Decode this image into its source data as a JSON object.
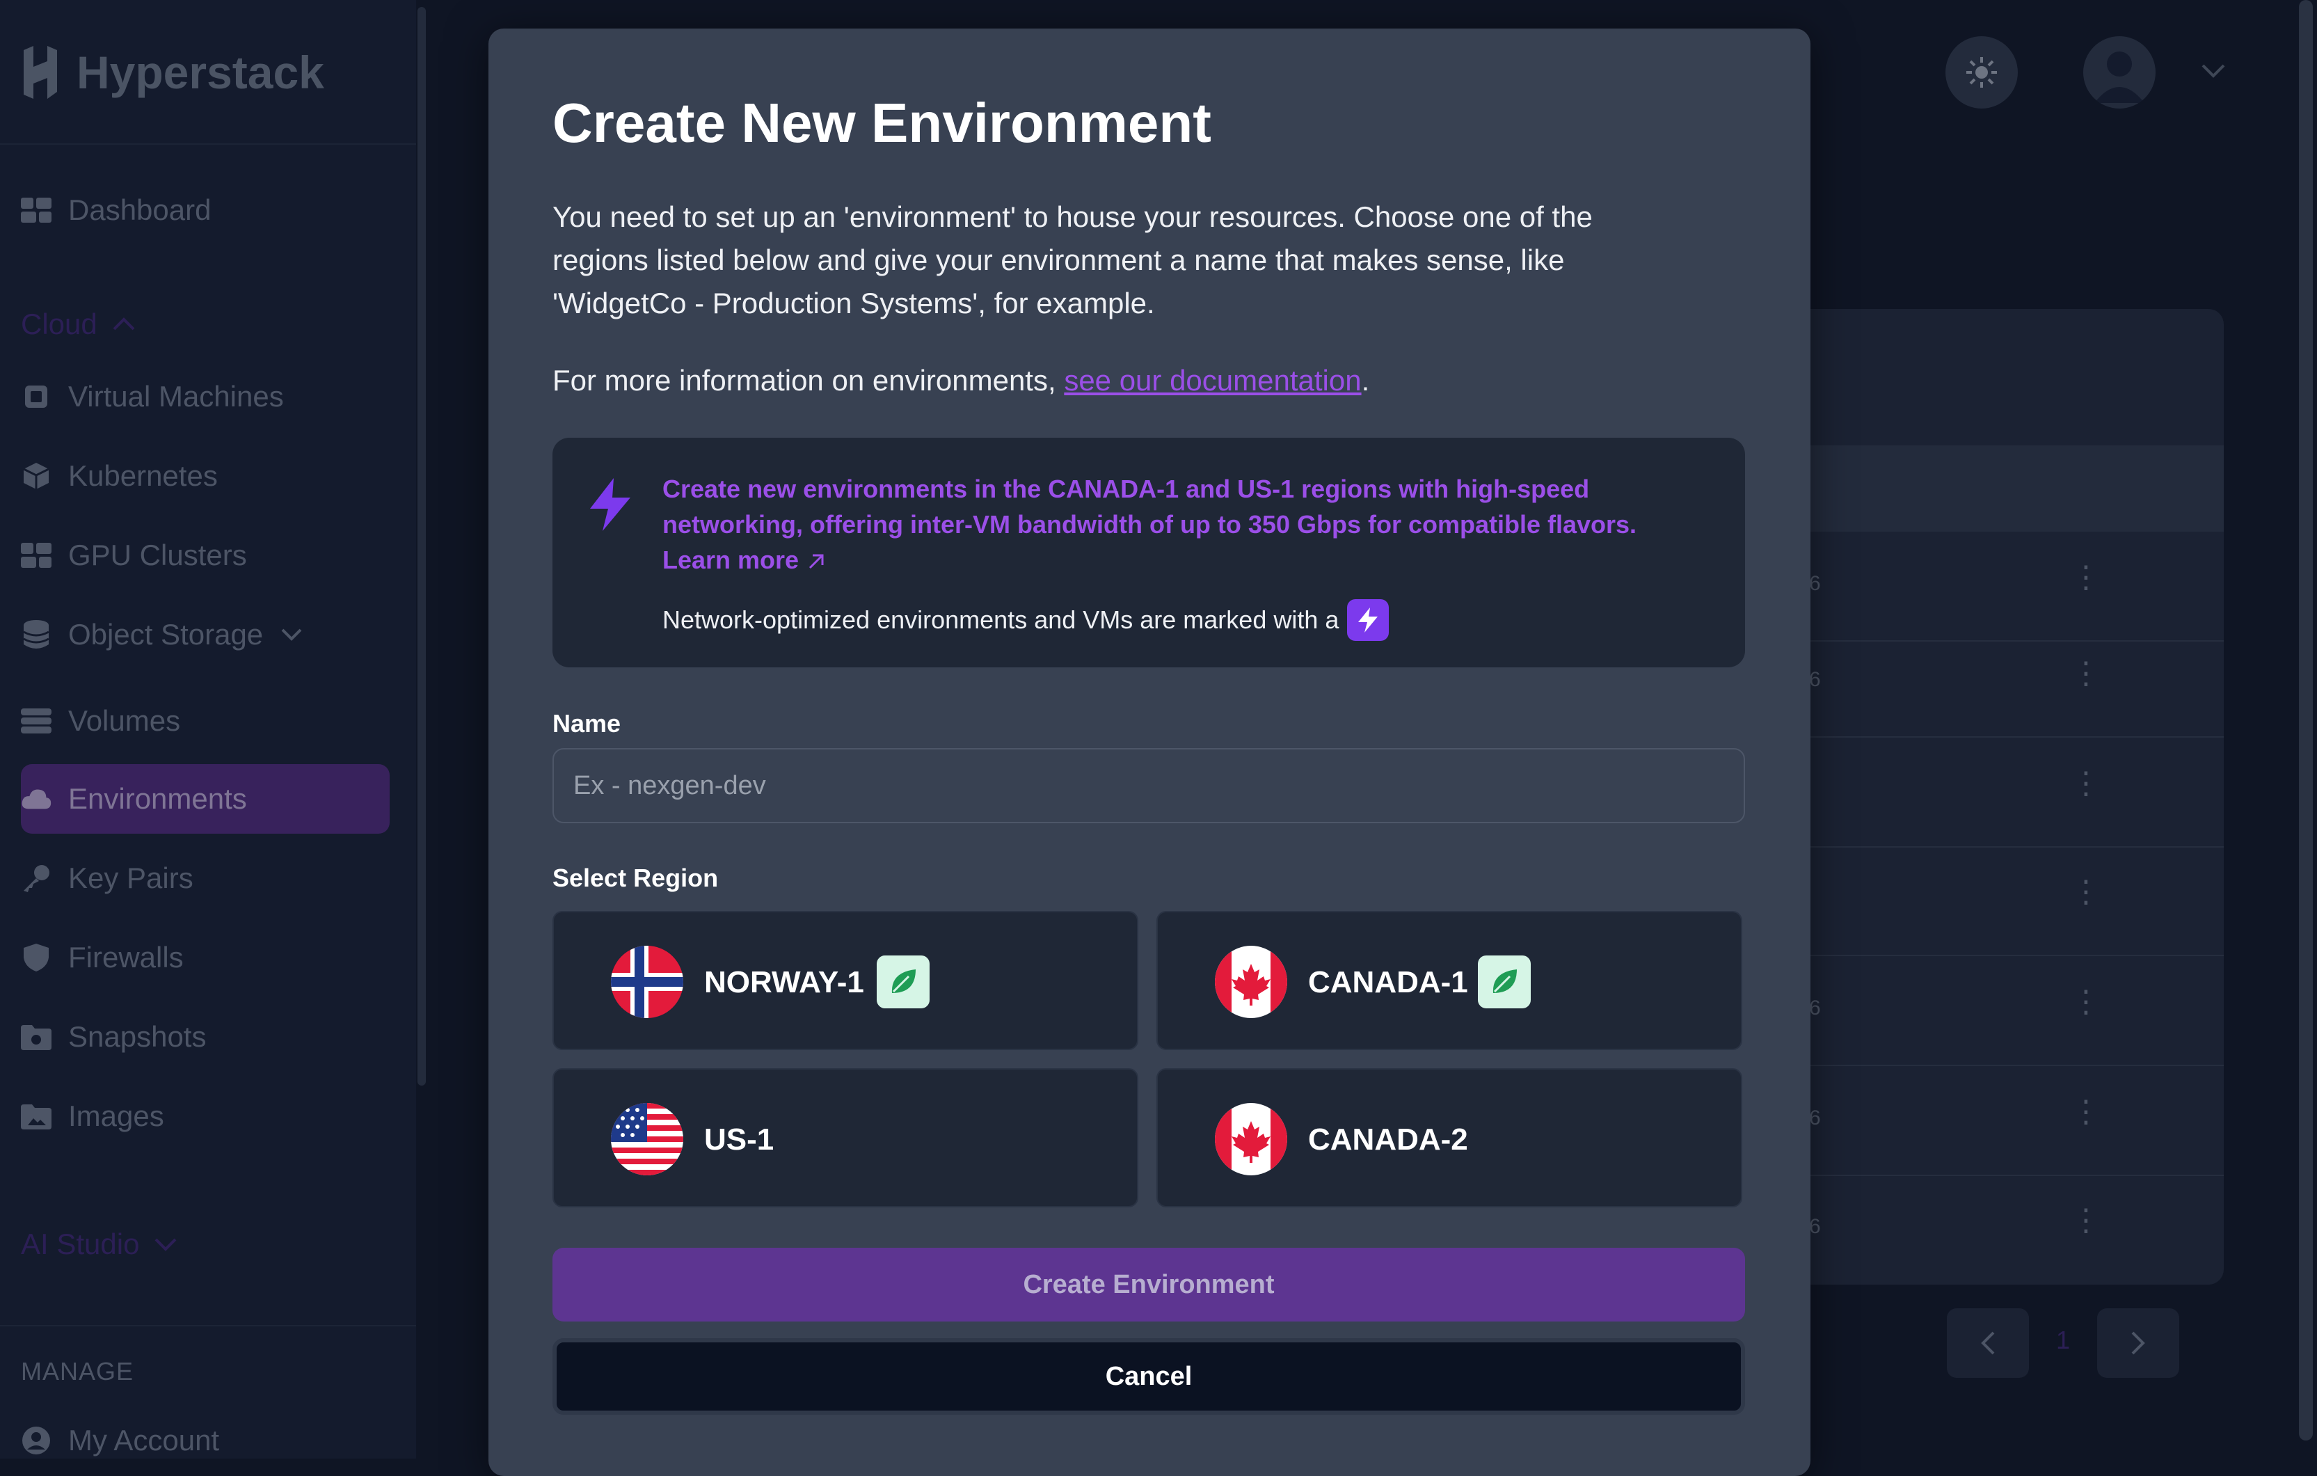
{
  "brand": {
    "name": "Hyperstack"
  },
  "sidebar": {
    "items": [
      {
        "label": "Dashboard",
        "icon": "dashboard-icon"
      },
      {
        "label": "Virtual Machines",
        "icon": "chip-icon"
      },
      {
        "label": "Kubernetes",
        "icon": "cube-icon"
      },
      {
        "label": "GPU Clusters",
        "icon": "cluster-icon"
      },
      {
        "label": "Object Storage",
        "icon": "database-icon"
      },
      {
        "label": "Volumes",
        "icon": "volume-icon"
      },
      {
        "label": "Environments",
        "icon": "cloud-icon",
        "active": true
      },
      {
        "label": "Key Pairs",
        "icon": "key-icon"
      },
      {
        "label": "Firewalls",
        "icon": "shield-icon"
      },
      {
        "label": "Snapshots",
        "icon": "camera-folder-icon"
      },
      {
        "label": "Images",
        "icon": "image-folder-icon"
      },
      {
        "label": "My Account",
        "icon": "user-icon"
      }
    ],
    "sections": {
      "cloud": "Cloud",
      "ai_studio": "AI Studio",
      "manage": "MANAGE"
    }
  },
  "background": {
    "row_fragments": [
      "6",
      "6",
      "",
      "",
      "6",
      "6",
      "6"
    ],
    "page_number": "1"
  },
  "modal": {
    "title": "Create New Environment",
    "description": "You need to set up an 'environment' to house your resources. Choose one of the regions listed below and give your environment a name that makes sense, like 'WidgetCo - Production Systems', for example.",
    "info_prefix": "For more information on environments, ",
    "info_link": "see our documentation",
    "info_suffix": ".",
    "callout": {
      "text": "Create new environments in the CANADA-1 and US-1 regions with high-speed networking, offering inter-VM bandwidth of up to 350 Gbps for compatible flavors.",
      "learn_more": "Learn more",
      "note": "Network-optimized environments and VMs are marked with a"
    },
    "name_label": "Name",
    "name_placeholder": "Ex - nexgen-dev",
    "region_label": "Select Region",
    "regions": [
      {
        "name": "NORWAY-1",
        "green": true
      },
      {
        "name": "CANADA-1",
        "green": true
      },
      {
        "name": "US-1",
        "green": false
      },
      {
        "name": "CANADA-2",
        "green": false
      }
    ],
    "create_label": "Create Environment",
    "cancel_label": "Cancel"
  },
  "colors": {
    "accent": "#9b4fe8",
    "modal_bg": "#384152",
    "page_bg": "#0f1524"
  }
}
